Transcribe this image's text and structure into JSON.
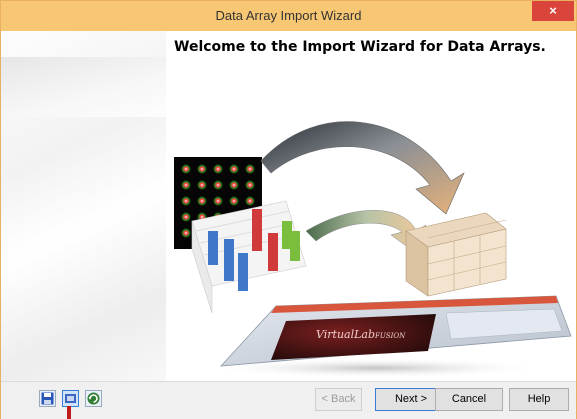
{
  "window": {
    "title": "Data Array Import Wizard",
    "close_glyph": "×",
    "close_icon": "close-icon",
    "accent_color": "#f7c774"
  },
  "main": {
    "heading": "Welcome to the Import Wizard for Data Arrays."
  },
  "illustration": {
    "splash_brand_text": "VirtualLab",
    "splash_brand_suffix": "FUSION"
  },
  "toolbar": {
    "icons": [
      "save-icon",
      "open-icon",
      "refresh-icon"
    ]
  },
  "buttons": {
    "back": "< Back",
    "next": "Next >",
    "cancel": "Cancel",
    "help": "Help"
  }
}
